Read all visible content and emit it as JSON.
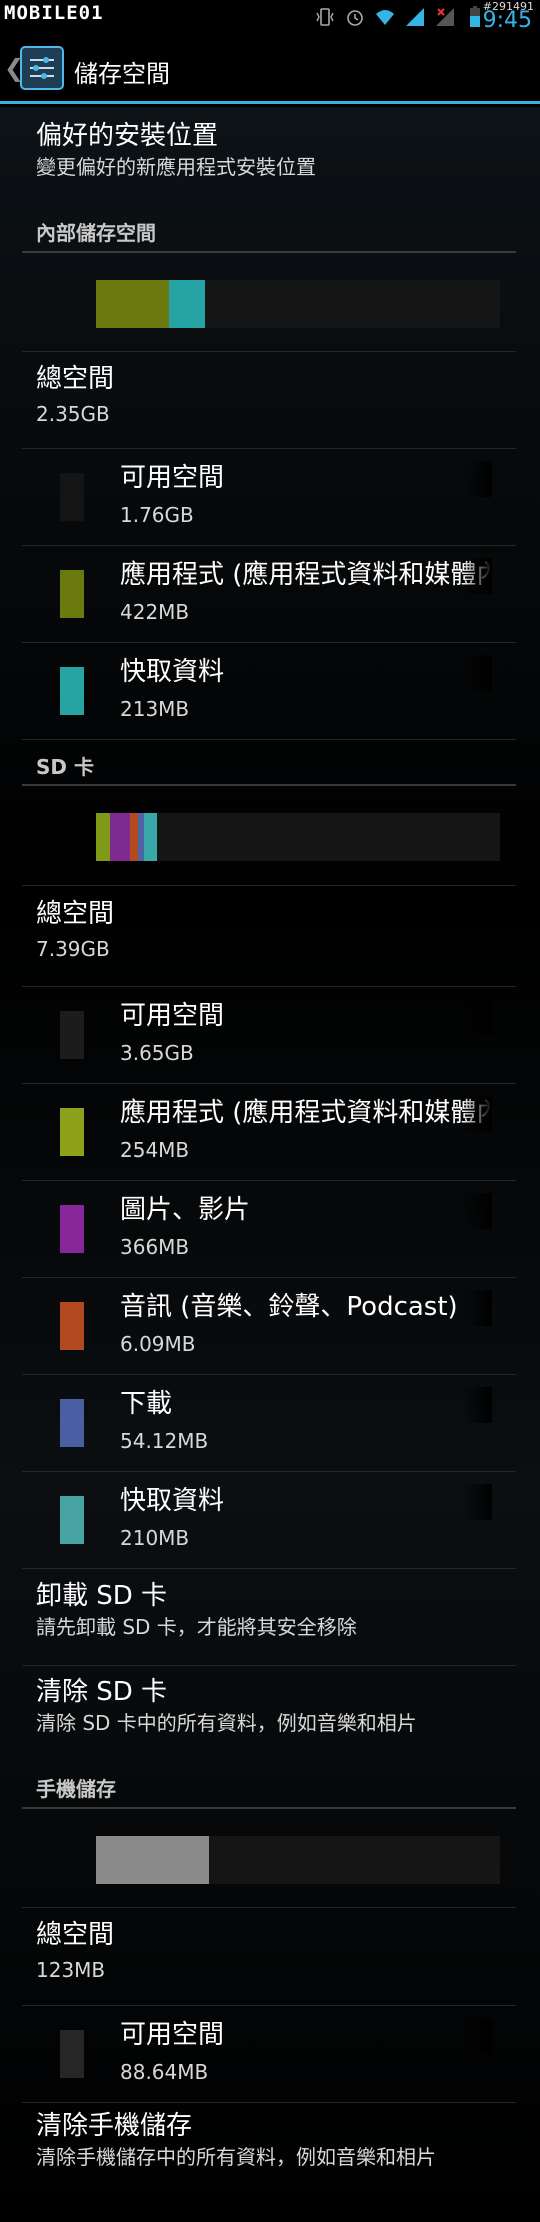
{
  "status_bar": {
    "logo": "MOBILE01",
    "watermark": "#291491",
    "clock": "9:45",
    "icons": [
      "vibrate-icon",
      "alarm-icon",
      "wifi-icon",
      "signal-icon",
      "no-signal-icon",
      "battery-icon"
    ]
  },
  "action_bar": {
    "title": "儲存空間",
    "icon": "storage-settings-icon"
  },
  "preferred_install": {
    "title": "偏好的安裝位置",
    "summary": "變更偏好的新應用程式安裝位置"
  },
  "internal": {
    "category": "內部儲存空間",
    "bar": [
      {
        "name": "apps",
        "fraction": 0.18,
        "color": "#6b7a0e"
      },
      {
        "name": "cache",
        "fraction": 0.09,
        "color": "#26a3a3"
      }
    ],
    "total_title": "總空間",
    "total_value": "2.35GB",
    "items": [
      {
        "label": "可用空間",
        "size": "1.76GB",
        "color": "#141414"
      },
      {
        "label": "應用程式 (應用程式資料和媒體內容)",
        "size": "422MB",
        "color": "#6b7a0e"
      },
      {
        "label": "快取資料",
        "size": "213MB",
        "color": "#26a3a3"
      }
    ]
  },
  "sd": {
    "category": "SD 卡",
    "bar": [
      {
        "name": "apps",
        "fraction": 0.035,
        "color": "#7f9a17"
      },
      {
        "name": "pictures",
        "fraction": 0.05,
        "color": "#7f2a8f"
      },
      {
        "name": "audio",
        "fraction": 0.02,
        "color": "#b54a1e"
      },
      {
        "name": "downloads",
        "fraction": 0.015,
        "color": "#4f63a8"
      },
      {
        "name": "cache",
        "fraction": 0.03,
        "color": "#3aa8a8"
      }
    ],
    "total_title": "總空間",
    "total_value": "7.39GB",
    "items": [
      {
        "label": "可用空間",
        "size": "3.65GB",
        "color": "#1c1c1c"
      },
      {
        "label": "應用程式 (應用程式資料和媒體內容)",
        "size": "254MB",
        "color": "#8ea11b"
      },
      {
        "label": "圖片、影片",
        "size": "366MB",
        "color": "#86289a"
      },
      {
        "label": "音訊 (音樂、鈴聲、Podcast)",
        "size": "6.09MB",
        "color": "#b34a1f"
      },
      {
        "label": "下載",
        "size": "54.12MB",
        "color": "#4a5fa3"
      },
      {
        "label": "快取資料",
        "size": "210MB",
        "color": "#48a3a3"
      }
    ],
    "unmount_title": "卸載 SD 卡",
    "unmount_summary": "請先卸載 SD 卡，才能將其安全移除",
    "erase_title": "清除 SD 卡",
    "erase_summary": "清除 SD 卡中的所有資料，例如音樂和相片"
  },
  "phone": {
    "category": "手機儲存",
    "bar": [
      {
        "name": "used",
        "fraction": 0.28,
        "color": "#8a8a8a"
      }
    ],
    "total_title": "總空間",
    "total_value": "123MB",
    "items": [
      {
        "label": "可用空間",
        "size": "88.64MB",
        "color": "#262626"
      }
    ],
    "erase_title": "清除手機儲存",
    "erase_summary": "清除手機儲存中的所有資料，例如音樂和相片"
  }
}
